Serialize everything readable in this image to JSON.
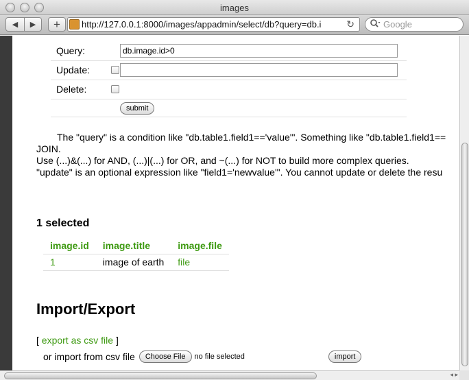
{
  "window": {
    "title": "images"
  },
  "toolbar": {
    "back_label": "◀",
    "forward_label": "▶",
    "add_label": "+",
    "url": "http://127.0.0.1:8000/images/appadmin/select/db?query=db.i",
    "reload_label": "↻",
    "search_placeholder": "Google"
  },
  "form": {
    "query_label": "Query:",
    "query_value": "db.image.id>0",
    "update_label": "Update:",
    "update_value": "",
    "delete_label": "Delete:",
    "submit_label": "submit"
  },
  "help": {
    "line1": "The \"query\" is a condition like \"db.table1.field1=='value'\". Something like \"db.table1.field1==",
    "line2": "JOIN.",
    "line3": "Use (...)&(...) for AND, (...)|(...) for OR, and ~(...) for NOT to build more complex queries.",
    "line4": "\"update\" is an optional expression like \"field1='newvalue'\". You cannot update or delete the resu"
  },
  "results": {
    "count_text": "1 selected",
    "columns": [
      "image.id",
      "image.title",
      "image.file"
    ],
    "rows": [
      {
        "id": "1",
        "title": "image of earth",
        "file": "file"
      }
    ]
  },
  "import_export": {
    "heading": "Import/Export",
    "open_bracket": "[",
    "export_link": "export as csv file",
    "close_bracket": "]",
    "import_text": "or import from csv file",
    "choose_label": "Choose File",
    "no_file_text": "no file selected",
    "import_label": "import"
  },
  "scrollbar": {
    "arrow_left": "◂",
    "arrow_right": "▸"
  }
}
